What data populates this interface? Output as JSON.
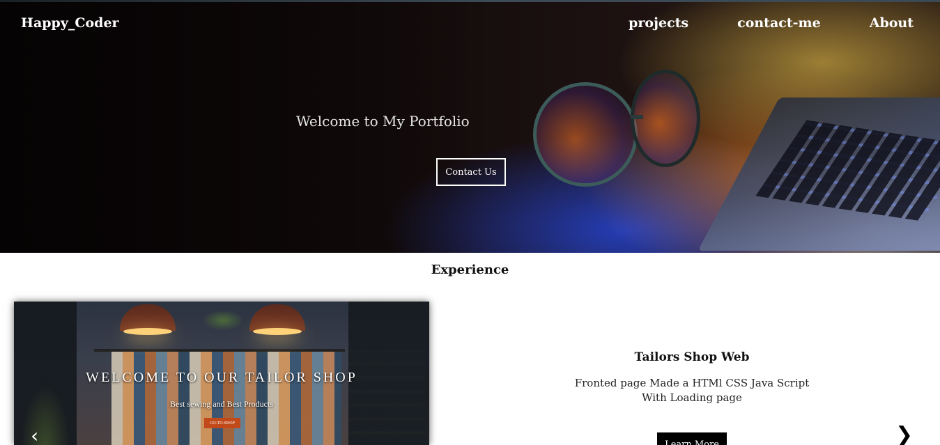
{
  "header": {
    "brand": "Happy_Coder",
    "nav": [
      {
        "label": "projects"
      },
      {
        "label": "contact-me"
      },
      {
        "label": "About"
      }
    ]
  },
  "hero": {
    "title": "Welcome to My Portfolio",
    "button_label": "Contact Us"
  },
  "experience": {
    "heading": "Experience",
    "project": {
      "image": {
        "title": "WELCOME TO OUR TAILOR SHOP",
        "subtitle": "Best sewing and Best Products",
        "button_label": "GO-TO-SHOP"
      },
      "title": "Tailors Shop Web",
      "description_line1": "Fronted page Made a HTMl CSS Java Script",
      "description_line2": "With Loading page",
      "button_label": "Learn More"
    },
    "prev_icon": "‹",
    "next_icon": "❯"
  }
}
